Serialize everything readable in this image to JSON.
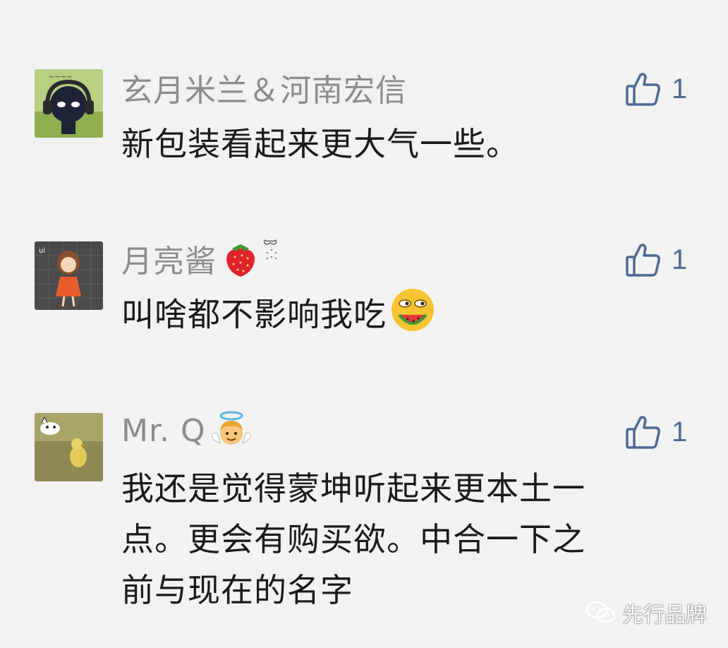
{
  "comments": [
    {
      "avatar_icon": "avatar-headphones-character",
      "name": "玄月米兰＆河南宏信",
      "name_emojis": [],
      "likes": "1",
      "content_lines": [
        "新包装看起来更大气一些。"
      ]
    },
    {
      "avatar_icon": "avatar-girl-cartoon",
      "name": "月亮酱",
      "name_emojis": [
        "strawberry-emoji",
        "sparkle-bow-emoji"
      ],
      "likes": "1",
      "content_lines": [
        "叫啥都不影响我吃"
      ],
      "content_emoji": "eating-watermelon-emoji"
    },
    {
      "avatar_icon": "avatar-duckling-photo",
      "name": "Mr. Q",
      "name_emojis": [
        "angel-emoji"
      ],
      "likes": "1",
      "content_lines": [
        "我还是觉得蒙坤听起来更本土一",
        "点。更会有购买欲。中合一下之",
        "前与现在的名字"
      ]
    }
  ],
  "watermark": {
    "icon": "wechat-logo-icon",
    "text": "先行品牌"
  },
  "colors": {
    "background": "#f2f2f2",
    "name": "#8c8c8c",
    "like_accent": "#4e6a93",
    "content": "#1a1a1a"
  }
}
